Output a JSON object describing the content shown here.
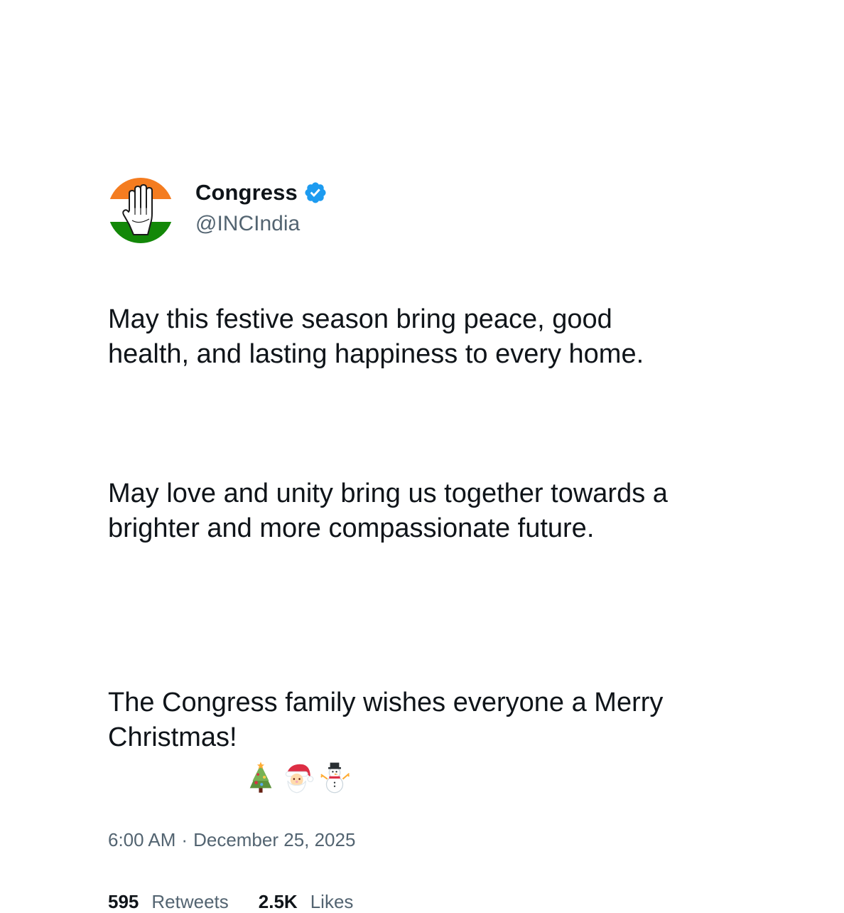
{
  "author": {
    "display_name": "Congress",
    "handle": "@INCIndia",
    "verified": true,
    "avatar_icon": "congress-hand-icon",
    "colors": {
      "saffron": "#f47c20",
      "green": "#138808",
      "verified_blue": "#1d9bf0"
    }
  },
  "tweet": {
    "paragraphs": [
      "May this festive season bring peace, good health, and lasting happiness to every home.",
      "May love and unity bring us together towards a brighter and more compassionate future.",
      "The Congress family wishes everyone a Merry Christmas!"
    ],
    "emojis": [
      "christmas-tree-icon",
      "santa-icon",
      "snowman-icon"
    ]
  },
  "meta": {
    "time": "6:00 AM",
    "separator": "·",
    "date": "December 25, 2025"
  },
  "stats": {
    "retweets_count": "595",
    "retweets_label": "Retweets",
    "likes_count": "2.5K",
    "likes_label": "Likes"
  }
}
